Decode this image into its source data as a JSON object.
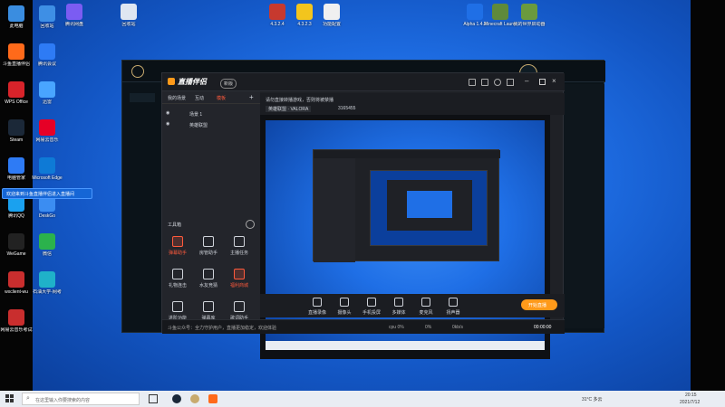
{
  "desktop_icons_left": [
    {
      "label": "此电脑",
      "color": "#3a8de0"
    },
    {
      "label": "斗鱼直播伴侣",
      "color": "#ff6a1a"
    },
    {
      "label": "WPS Office",
      "color": "#d8232a"
    },
    {
      "label": "Steam",
      "color": "#1b2838"
    },
    {
      "label": "电脑管家",
      "color": "#2e7bf5"
    },
    {
      "label": "腾讯QQ",
      "color": "#1aa1ef"
    },
    {
      "label": "WeGame",
      "color": "#222222"
    },
    {
      "label": "wxclient-wu",
      "color": "#c92e2e"
    },
    {
      "label": "网易云音乐考试",
      "color": "#c92e2e"
    }
  ],
  "desktop_icons_left2": [
    {
      "label": "回收站",
      "color": "#3e8fe5"
    },
    {
      "label": "腾讯会议",
      "color": "#2e7bf5"
    },
    {
      "label": "迅雷",
      "color": "#49a5ff"
    },
    {
      "label": "网易云音乐",
      "color": "#e60026"
    },
    {
      "label": "Microsoft Edge",
      "color": "#0e7ad6"
    },
    {
      "label": "DeskGo",
      "color": "#3b8df2"
    },
    {
      "label": "微信",
      "color": "#2bb24c"
    },
    {
      "label": "石油大学-网考",
      "color": "#1fb1c9"
    }
  ],
  "desktop_icons_top": [
    {
      "label": "腾讯网盘",
      "color": "#7b5cf2"
    },
    {
      "label": "回收站",
      "color": "#dfe7f1"
    },
    {
      "label": "4.3.2.4",
      "color": "#c7392e"
    },
    {
      "label": "4.3.2.3",
      "color": "#f3c51d"
    },
    {
      "label": "功能配置",
      "color": "#f0f0f0"
    },
    {
      "label": "Alpha 1.4.2",
      "color": "#1f6fe6"
    },
    {
      "label": "Minecraft Launcher",
      "color": "#5f8a3a"
    },
    {
      "label": "我的世界启动器",
      "color": "#6a9a3e"
    }
  ],
  "tooltip": "欢迎来到斗鱼直播伴侣进入直播间",
  "obs": {
    "title": "直播伴侣",
    "badge": "新版",
    "tabs": [
      "我的场景",
      "互动",
      "模板"
    ],
    "active_tab": 2,
    "scenes": [
      "场景 1",
      "英雄联盟"
    ],
    "notice": "请勿直接转播游戏，否则将被禁播",
    "toolbox_label": "工具箱",
    "stream_title": "英雄联盟 · VALORA",
    "room_id": "3165455",
    "tools": [
      {
        "label": "弹幕助手",
        "hot": true
      },
      {
        "label": "房管助手",
        "hot": false
      },
      {
        "label": "主播任务",
        "hot": false
      },
      {
        "label": "礼物连击",
        "hot": false
      },
      {
        "label": "水友竞猜",
        "hot": false
      },
      {
        "label": "福利商城",
        "hot": true
      },
      {
        "label": "进阶功能",
        "hot": false
      },
      {
        "label": "弹幕库",
        "hot": false
      },
      {
        "label": "歌词助手",
        "hot": false
      }
    ],
    "bottom_tools": [
      "直播录像",
      "摄像头",
      "手机投屏",
      "多媒体",
      "麦克风",
      "扬声器"
    ],
    "start_button": "开始直播",
    "footer_text": "斗鱼公众号：全力守护用户，直播更加稳定，欢迎体验",
    "timer": "00:00:00",
    "stats": [
      "cpu 0%",
      "0%",
      "0kb/s"
    ]
  },
  "taskbar": {
    "search_placeholder": "在这里输入你要搜索的内容",
    "weather": "31°C 多云",
    "time": "20:15",
    "date": "2021/7/12"
  },
  "colors": {
    "accent": "#ff5a3c",
    "start": "#ff9a1a"
  }
}
